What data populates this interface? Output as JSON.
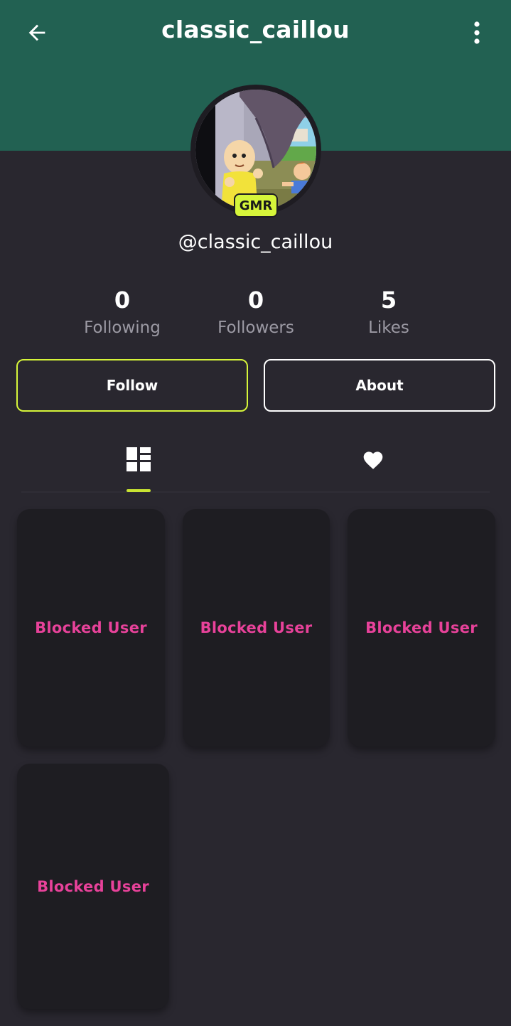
{
  "header": {
    "title": "classic_caillou",
    "back_icon": "arrow-left-icon",
    "menu_icon": "more-vertical-icon",
    "background_color": "#226152"
  },
  "profile": {
    "handle": "@classic_caillou",
    "badge": "GMR",
    "badge_color": "#d6f53a"
  },
  "stats": [
    {
      "value": "0",
      "label": "Following"
    },
    {
      "value": "0",
      "label": "Followers"
    },
    {
      "value": "5",
      "label": "Likes"
    }
  ],
  "actions": {
    "follow_label": "Follow",
    "about_label": "About",
    "accent_color": "#d6f53a"
  },
  "tabs": [
    {
      "icon": "grid-icon",
      "active": true
    },
    {
      "icon": "heart-icon",
      "active": false
    }
  ],
  "posts": [
    {
      "label": "Blocked User"
    },
    {
      "label": "Blocked User"
    },
    {
      "label": "Blocked User"
    },
    {
      "label": "Blocked User"
    }
  ],
  "blocked_label_color": "#e8429a"
}
